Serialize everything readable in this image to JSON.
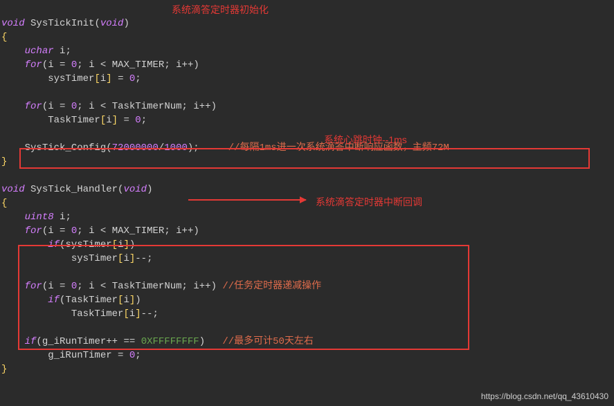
{
  "ann": {
    "init": "系统滴答定时器初始化",
    "heartbeat": "系统心跳时钟--1ms",
    "handler": "系统滴答定时器中断回调"
  },
  "c": {
    "void": "void",
    "fn_init": "SysTickInit",
    "fn_handler": "SysTick_Handler",
    "uchar": "uchar",
    "uint8": "uint8",
    "i": "i",
    "for": "for",
    "if": "if",
    "max_timer": "MAX_TIMER",
    "tasknum": "TaskTimerNum",
    "sysTimer": "sysTimer",
    "taskTimer": "TaskTimer",
    "systick_cfg": "SysTick_Config",
    "n72m": "72000000",
    "n1000": "1000",
    "cmnt_config": "//每隔1ms进一次系统滴答中断响应函数，主频72M",
    "cmnt_task": "//任务定时器递减操作",
    "g_iRunTimer": "g_iRunTimer",
    "hexF": "0XFFFFFFFF",
    "cmnt_50": "//最多可计50天左右",
    "zero": "0",
    "eq": "=",
    "eqeq": "==",
    "lt": "<",
    "pp": "++",
    "mm": "--",
    "semi": ";",
    "slash": "/",
    "lp": "(",
    "rp": ")",
    "lb": "[",
    "rb": "]",
    "lc": "{",
    "rc": "}"
  },
  "watermark": "https://blog.csdn.net/qq_43610430"
}
